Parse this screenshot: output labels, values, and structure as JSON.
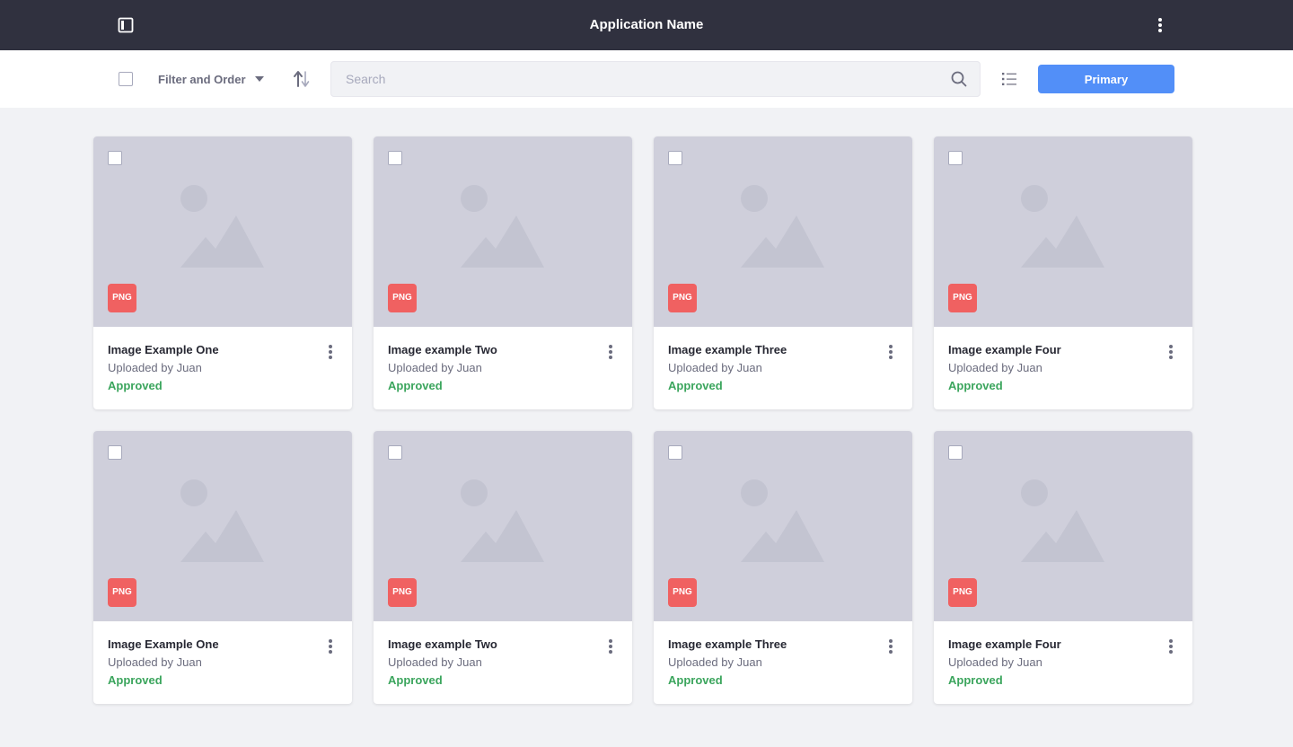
{
  "app": {
    "title": "Application Name",
    "sidebar_toggle_icon": "sidebar-toggle-icon",
    "menu_icon": "kebab-vertical-icon"
  },
  "toolbar": {
    "filter_label": "Filter and Order",
    "search_placeholder": "Search",
    "search_value": "",
    "primary_label": "Primary",
    "accent_color": "#528ff8"
  },
  "colors": {
    "header_bg": "#30313f",
    "badge_bg": "#f06161",
    "status_approved": "#3ba55d"
  },
  "cards": [
    {
      "title": "Image Example One",
      "subtitle": "Uploaded by Juan",
      "status": "Approved",
      "badge": "PNG"
    },
    {
      "title": "Image example Two",
      "subtitle": "Uploaded by Juan",
      "status": "Approved",
      "badge": "PNG"
    },
    {
      "title": "Image example Three",
      "subtitle": "Uploaded by Juan",
      "status": "Approved",
      "badge": "PNG"
    },
    {
      "title": "Image example Four",
      "subtitle": "Uploaded by Juan",
      "status": "Approved",
      "badge": "PNG"
    },
    {
      "title": "Image Example One",
      "subtitle": "Uploaded by Juan",
      "status": "Approved",
      "badge": "PNG"
    },
    {
      "title": "Image example Two",
      "subtitle": "Uploaded by Juan",
      "status": "Approved",
      "badge": "PNG"
    },
    {
      "title": "Image example Three",
      "subtitle": "Uploaded by Juan",
      "status": "Approved",
      "badge": "PNG"
    },
    {
      "title": "Image example Four",
      "subtitle": "Uploaded by Juan",
      "status": "Approved",
      "badge": "PNG"
    }
  ]
}
